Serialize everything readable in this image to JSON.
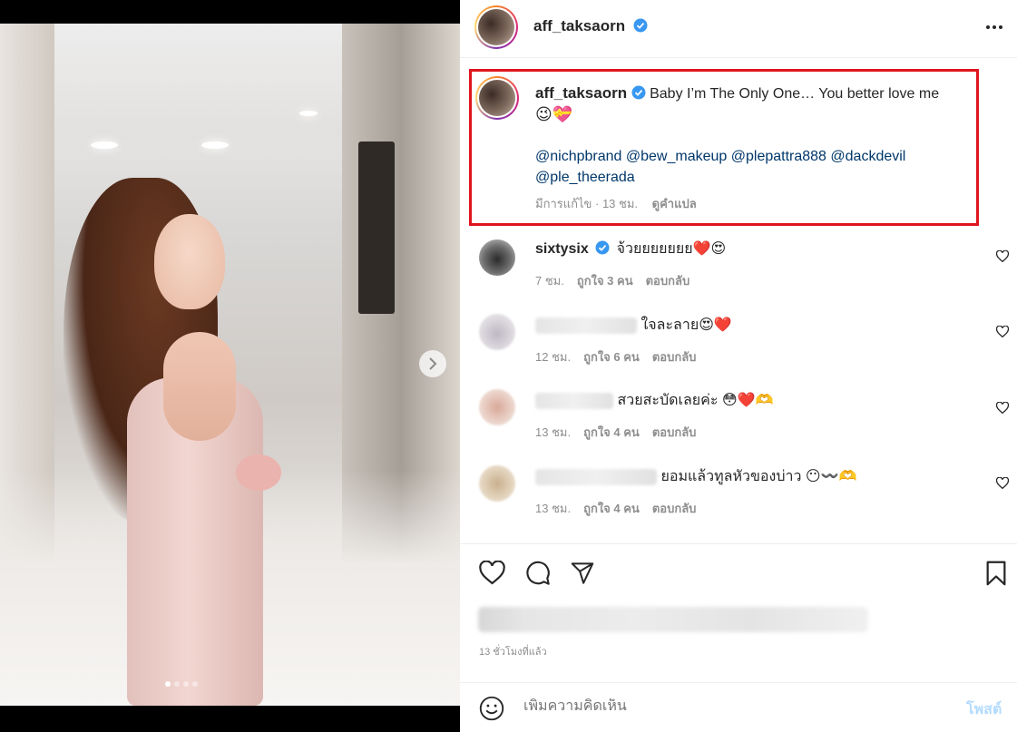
{
  "post": {
    "author": "aff_taksaorn",
    "caption_line1": "Baby I’m The Only One… You better love me",
    "caption_emoji": "😉💝",
    "mentions": [
      "@nichpbrand",
      "@bew_makeup",
      "@plepattra888",
      "@dackdevil",
      "@ple_theerada"
    ],
    "edited_label": "มีการแก้ไข · 13 ชม.",
    "translate_label": "ดูคำแปล",
    "time_ago": "13 ชั่วโมงที่แล้ว",
    "photo_index": 1,
    "photo_count": 4
  },
  "comments": [
    {
      "author": "sixtysix",
      "verified": true,
      "text": "จ้วยยยยยยย❤️😍",
      "time": "7 ชม.",
      "likes": "ถูกใจ 3 คน",
      "reply": "ตอบกลับ"
    },
    {
      "author": "",
      "verified": false,
      "text": "ใจละลาย😍❤️",
      "time": "12 ชม.",
      "likes": "ถูกใจ 6 คน",
      "reply": "ตอบกลับ"
    },
    {
      "author": "",
      "verified": false,
      "text": "สวยสะบัดเลยค่ะ 😳❤️🫶",
      "time": "13 ชม.",
      "likes": "ถูกใจ 4 คน",
      "reply": "ตอบกลับ"
    },
    {
      "author": "",
      "verified": false,
      "text": "ยอมแล้วทูลหัวของบ่าว 😶〰️🫶",
      "time": "13 ชม.",
      "likes": "ถูกใจ 4 คน",
      "reply": "ตอบกลับ"
    }
  ],
  "composer": {
    "placeholder": "เพิ่มความคิดเห็น",
    "post_label": "โพสต์"
  },
  "colors": {
    "highlight_border": "#e0141e",
    "verified_blue": "#3897f0",
    "mention": "#00376b",
    "muted": "#8e8e8e",
    "post_disabled": "#b3dbff"
  }
}
